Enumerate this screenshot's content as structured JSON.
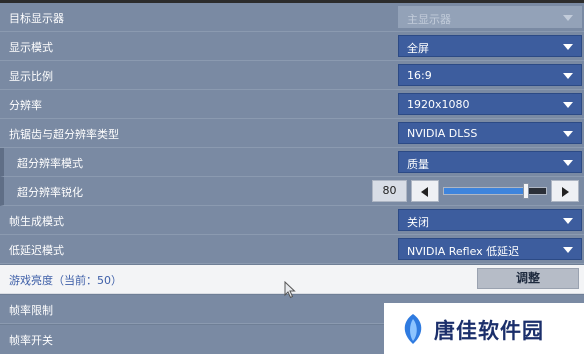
{
  "settings": {
    "target_display": {
      "label": "目标显示器",
      "value": "主显示器"
    },
    "display_mode": {
      "label": "显示模式",
      "value": "全屏"
    },
    "aspect_ratio": {
      "label": "显示比例",
      "value": "16:9"
    },
    "resolution": {
      "label": "分辨率",
      "value": "1920x1080"
    },
    "antialiasing": {
      "label": "抗锯齿与超分辨率类型",
      "value": "NVIDIA DLSS"
    },
    "sr_mode": {
      "label": "超分辨率模式",
      "value": "质量"
    },
    "sr_sharpening": {
      "label": "超分辨率锐化",
      "value": "80",
      "level_fraction": 0.8
    },
    "frame_generation": {
      "label": "帧生成模式",
      "value": "关闭"
    },
    "low_latency": {
      "label": "低延迟模式",
      "value": "NVIDIA Reflex 低延迟"
    },
    "brightness": {
      "label": "游戏亮度（当前：50）",
      "button": "调整"
    },
    "frame_limit": {
      "label": "帧率限制"
    },
    "frame_switch": {
      "label": "帧率开关"
    }
  },
  "watermark": {
    "text": "唐佳软件园"
  },
  "colors": {
    "row_bg": "#7a8aa3",
    "dropdown_bg": "#3d5d9e",
    "highlight_row_bg": "#f3f4f6",
    "slider_fill": "#3e84dc",
    "watermark_text": "#1b2f6b"
  },
  "icons": [
    "chevron-down-icon",
    "arrow-left-icon",
    "arrow-right-icon",
    "mouse-cursor-icon",
    "leaf-logo-icon"
  ]
}
